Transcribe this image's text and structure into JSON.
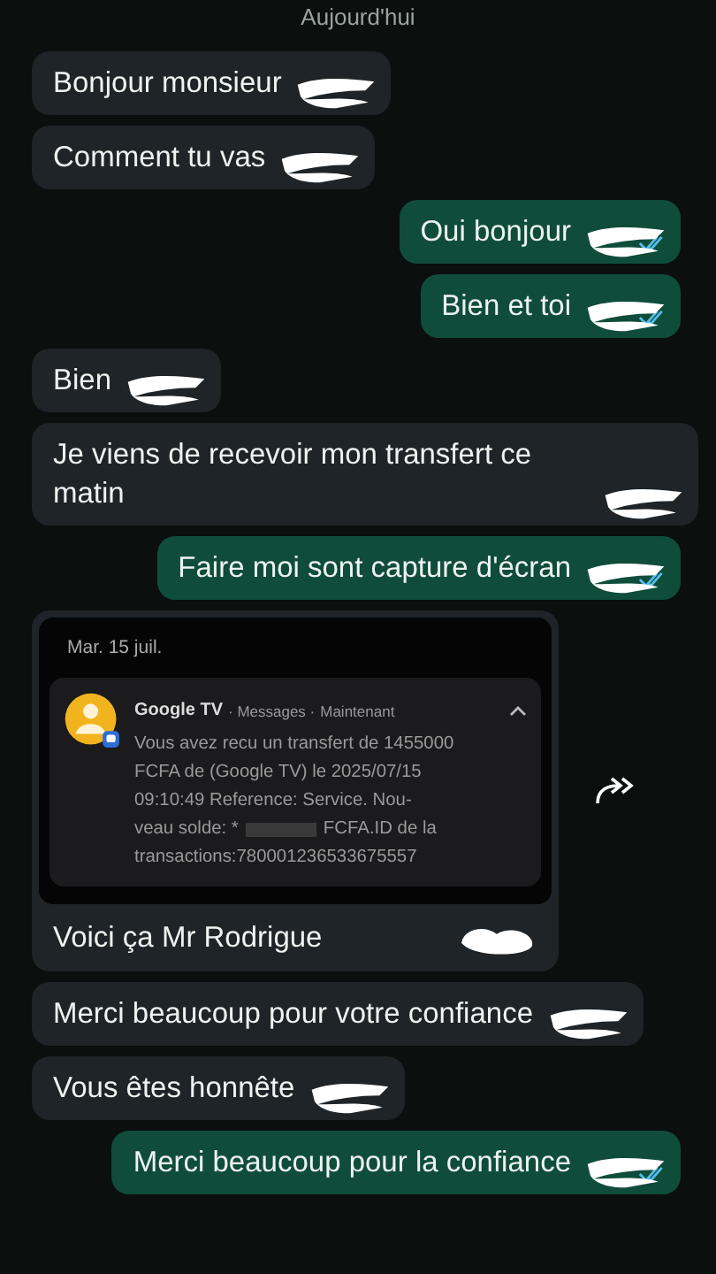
{
  "date_chip": "Aujourd'hui",
  "messages": [
    {
      "kind": "text",
      "outgoing": false,
      "text": "Bonjour monsieur",
      "redacted": true
    },
    {
      "kind": "text",
      "outgoing": false,
      "text": "Comment tu vas",
      "redacted": true
    },
    {
      "kind": "text",
      "outgoing": true,
      "text": "Oui bonjour",
      "redacted": true
    },
    {
      "kind": "text",
      "outgoing": true,
      "text": "Bien et toi",
      "redacted": true
    },
    {
      "kind": "text",
      "outgoing": false,
      "text": "Bien",
      "redacted": true
    },
    {
      "kind": "text",
      "outgoing": false,
      "text": "Je viens de recevoir mon transfert ce matin",
      "redacted": true
    },
    {
      "kind": "text",
      "outgoing": true,
      "text": "Faire moi sont capture d'écran",
      "redacted": true
    },
    {
      "kind": "image",
      "outgoing": false,
      "caption": "Voici ça Mr Rodrigue",
      "redacted": true,
      "forward": true,
      "screenshot": {
        "date": "Mar. 15 juil.",
        "app": "Google TV",
        "source": "· Messages ·",
        "time": "Maintenant",
        "lines": [
          {
            "parts": [
              "Vous avez recu un transfert de 1455000"
            ]
          },
          {
            "parts": [
              "FCFA de (Google TV) le 2025/07/15"
            ]
          },
          {
            "parts": [
              "09:10:49 Reference: Service. Nou-"
            ]
          },
          {
            "parts": [
              "veau solde: *",
              "FCFA.ID de la"
            ]
          },
          {
            "parts": [
              "transactions:780001236533675557"
            ]
          }
        ]
      }
    },
    {
      "kind": "text",
      "outgoing": false,
      "text": "Merci beaucoup pour votre confiance",
      "redacted": true
    },
    {
      "kind": "text",
      "outgoing": false,
      "text": "Vous êtes honnête",
      "redacted": true
    },
    {
      "kind": "text",
      "outgoing": true,
      "text": "Merci beaucoup pour la confiance",
      "redacted": true
    }
  ]
}
